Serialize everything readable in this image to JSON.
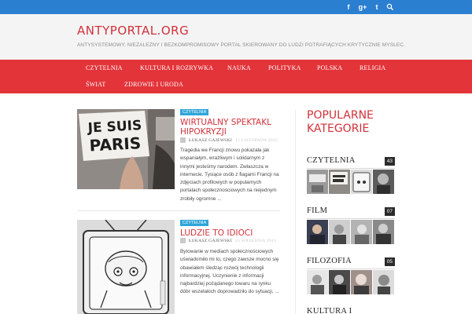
{
  "topbar": {
    "icons": [
      "facebook-icon",
      "google-plus-icon",
      "twitter-icon",
      "search-icon"
    ],
    "facebook_glyph": "f",
    "googleplus_glyph": "g+",
    "twitter_glyph": "t",
    "color": "#2b7fd0"
  },
  "header": {
    "title": "ANTYPORTAL.ORG",
    "tagline": "ANTYSYSTEMOWY, NIEZALEŻNY I BEZKOMPROMISOWY PORTAL SKIEROWANY DO LUDZI POTRAFIĄCYCH KRYTYCZNIE MYŚLEĆ."
  },
  "nav": {
    "color": "#e3343a",
    "items": [
      {
        "label": "CZYTELNIA"
      },
      {
        "label": "KULTURA I ROZRYWKA"
      },
      {
        "label": "NAUKA"
      },
      {
        "label": "POLITYKA"
      },
      {
        "label": "POLSKA"
      },
      {
        "label": "RELIGIA"
      },
      {
        "label": "ŚWIAT"
      },
      {
        "label": "ZDROWIE I URODA"
      }
    ]
  },
  "posts": [
    {
      "category": "CZYTELNIA",
      "title_line1": "WIRTUALNY SPEKTAKL",
      "title_line2": "HIPOKRYZJI",
      "author": "ŁUKASZ GAJEWSKI",
      "date": "15 LISTOPADA 2015",
      "image_text_1": "JE SUIS",
      "image_text_2": "PARIS",
      "excerpt": "Tragedia we Francji znowu pokazała jak wspaniałym, wrażliwym i solidarnym z innymi jesteśmy narodem. Zwłaszcza w internecie. Tysiące osób z flagami Francji na zdjęciach profilowych w popularnych portalach społecznościowych na niejednym zrobiły ogromne ..."
    },
    {
      "category": "CZYTELNIA",
      "title_line1": "LUDZIE TO IDIOCI",
      "author": "ŁUKASZ GAJEWSKI",
      "date": "25 WRZEŚNIA 2015",
      "excerpt": "Bytowanie w mediach społecznościowych uświadomiło mi to, czego zawsze mocno się obawiałem śledząc rozwój technologii informacyjnej. Uczynienie z informacji najbardziej pożądanego towaru na rynku dóbr wszelakich doprowadziło do sytuacji, ..."
    }
  ],
  "sidebar": {
    "title_line1": "POPULARNE",
    "title_line2": "KATEGORIE",
    "categories": [
      {
        "name": "CZYTELNIA",
        "count": "43"
      },
      {
        "name": "FILM",
        "count": "07"
      },
      {
        "name": "FILOZOFIA",
        "count": "05"
      },
      {
        "name": "KULTURA I",
        "count": ""
      }
    ]
  },
  "colors": {
    "accent": "#d1313a",
    "badge": "#2fa5d8",
    "count": "#2b2b2b"
  }
}
